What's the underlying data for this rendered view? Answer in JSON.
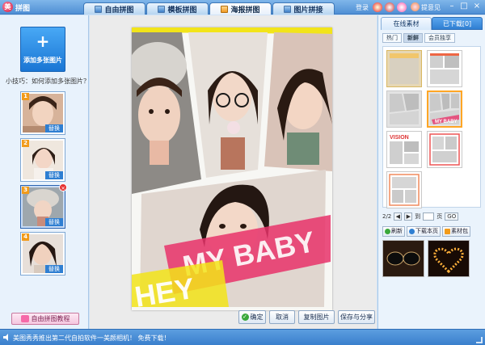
{
  "app": {
    "title": "拼图",
    "icon": "app-logo-icon"
  },
  "tabs": [
    {
      "label": "自由拼图",
      "active": false
    },
    {
      "label": "模板拼图",
      "active": false
    },
    {
      "label": "海报拼图",
      "active": true
    },
    {
      "label": "图片拼接",
      "active": false
    }
  ],
  "header": {
    "login": "登录",
    "feedback": "提意见",
    "minimize": "–",
    "maximize": "□",
    "close": "×"
  },
  "left": {
    "add_label": "添加多张图片",
    "tip": "小技巧：如何添加多张图片？",
    "replace_label": "替换",
    "thumbnails": [
      {
        "num": "1"
      },
      {
        "num": "2"
      },
      {
        "num": "3",
        "selected": true
      },
      {
        "num": "4"
      }
    ],
    "tutorial": "自由拼图教程"
  },
  "poster": {
    "overlay_text_1": "MY BABY",
    "overlay_text_2": "HEY"
  },
  "actions": {
    "ok": "确定",
    "cancel": "取消",
    "copy": "复制图片",
    "save": "保存与分享"
  },
  "right": {
    "tab_online": "在线素材",
    "tab_downloaded": "已下载[0]",
    "subtabs": [
      "热门",
      "新鲜",
      "会员独享"
    ],
    "active_subtab": "新鲜",
    "template_labels": {
      "t5": "MY BABY",
      "t6": "VISION"
    },
    "pager": {
      "current": "2/2",
      "to": "到",
      "page": "页",
      "go": "GO"
    },
    "tools": {
      "refresh": "刷新",
      "download_page": "下载本页",
      "pack": "素材包"
    }
  },
  "status": {
    "text": "美图秀秀推出第二代自拍软件一美颜相机！ 免费下载！"
  },
  "colors": {
    "accent": "#2f7fd2",
    "title_bg": "#4f8fd4",
    "poster_pink": "#e8336a",
    "poster_yellow": "#f2e419"
  }
}
